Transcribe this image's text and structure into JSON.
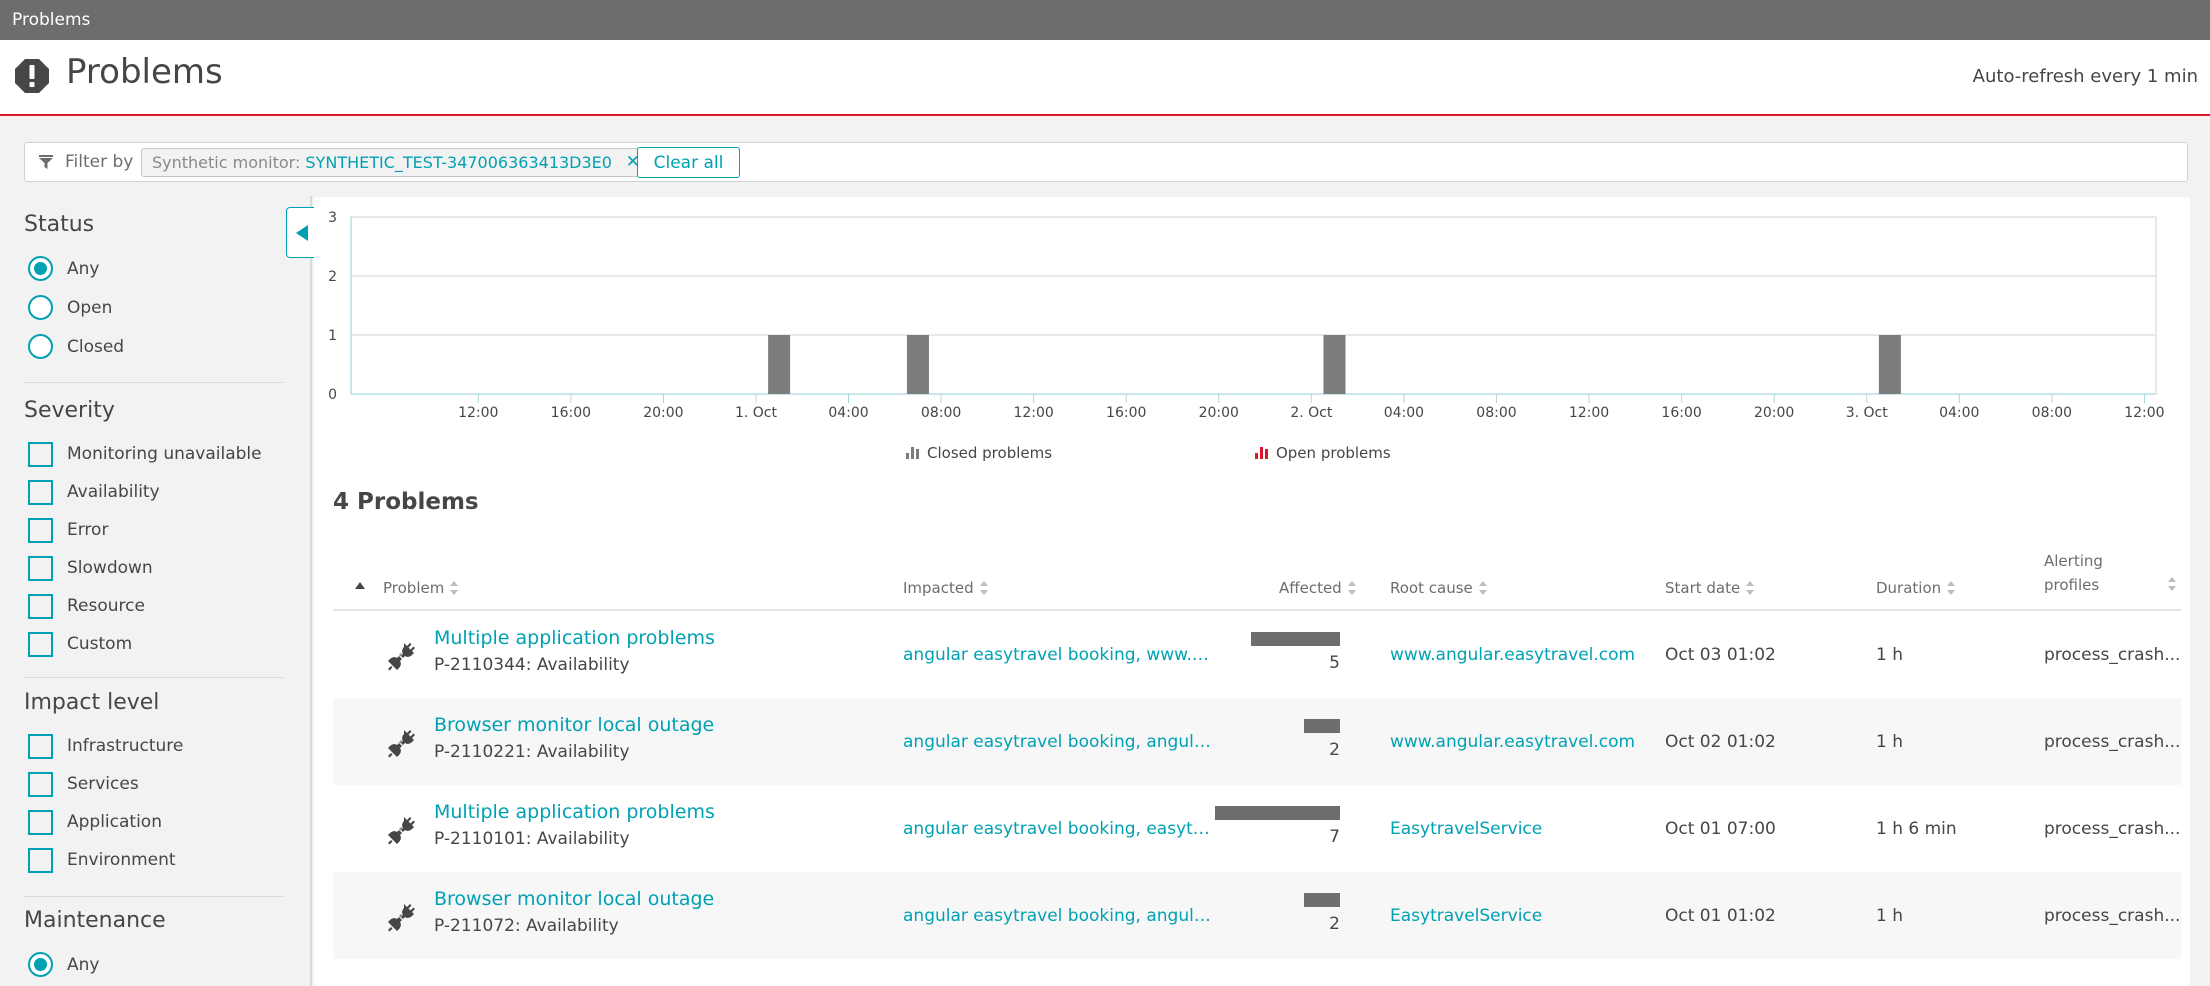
{
  "window": {
    "title": "Problems"
  },
  "header": {
    "title": "Problems",
    "icon": "exclamation-octagon-icon",
    "auto_refresh": "Auto-refresh every 1 min"
  },
  "filter": {
    "label": "Filter by",
    "chips": [
      {
        "key": "Synthetic monitor: ",
        "value": "SYNTHETIC_TEST-347006363413D3E0"
      }
    ],
    "clear_all": "Clear all"
  },
  "sidebar": {
    "status": {
      "title": "Status",
      "options": [
        {
          "label": "Any",
          "checked": true
        },
        {
          "label": "Open",
          "checked": false
        },
        {
          "label": "Closed",
          "checked": false
        }
      ]
    },
    "severity": {
      "title": "Severity",
      "options": [
        {
          "label": "Monitoring unavailable"
        },
        {
          "label": "Availability"
        },
        {
          "label": "Error"
        },
        {
          "label": "Slowdown"
        },
        {
          "label": "Resource"
        },
        {
          "label": "Custom"
        }
      ]
    },
    "impact": {
      "title": "Impact level",
      "options": [
        {
          "label": "Infrastructure"
        },
        {
          "label": "Services"
        },
        {
          "label": "Application"
        },
        {
          "label": "Environment"
        }
      ]
    },
    "maintenance": {
      "title": "Maintenance",
      "options": [
        {
          "label": "Any",
          "checked": true
        }
      ]
    }
  },
  "chart_data": {
    "type": "bar",
    "title": "",
    "xlabel": "",
    "ylabel": "",
    "ylim": [
      0,
      3
    ],
    "yticks": [
      0,
      1,
      2,
      3
    ],
    "grid": true,
    "x_range_hours_from_first_tick": [
      -5.5,
      72.5
    ],
    "xticks": [
      {
        "label": "12:00",
        "hour": 0
      },
      {
        "label": "16:00",
        "hour": 4
      },
      {
        "label": "20:00",
        "hour": 8
      },
      {
        "label": "1. Oct",
        "hour": 12
      },
      {
        "label": "04:00",
        "hour": 16
      },
      {
        "label": "08:00",
        "hour": 20
      },
      {
        "label": "12:00",
        "hour": 24
      },
      {
        "label": "16:00",
        "hour": 28
      },
      {
        "label": "20:00",
        "hour": 32
      },
      {
        "label": "2. Oct",
        "hour": 36
      },
      {
        "label": "04:00",
        "hour": 40
      },
      {
        "label": "08:00",
        "hour": 44
      },
      {
        "label": "12:00",
        "hour": 48
      },
      {
        "label": "16:00",
        "hour": 52
      },
      {
        "label": "20:00",
        "hour": 56
      },
      {
        "label": "3. Oct",
        "hour": 60
      },
      {
        "label": "04:00",
        "hour": 64
      },
      {
        "label": "08:00",
        "hour": 68
      },
      {
        "label": "12:00",
        "hour": 72
      }
    ],
    "series": [
      {
        "name": "Closed problems",
        "color": "#7c7c7c",
        "points": [
          {
            "time": "1. Oct 01:00",
            "hour": 13,
            "value": 1
          },
          {
            "time": "1. Oct 07:00",
            "hour": 19,
            "value": 1
          },
          {
            "time": "2. Oct 01:00",
            "hour": 37,
            "value": 1
          },
          {
            "time": "3. Oct 01:00",
            "hour": 61,
            "value": 1
          }
        ]
      },
      {
        "name": "Open problems",
        "color": "#dc172a",
        "points": []
      }
    ],
    "legend": [
      "Closed problems",
      "Open problems"
    ],
    "legend_position": "bottom"
  },
  "problems": {
    "count_label": "4 Problems",
    "columns": {
      "problem": "Problem",
      "impacted": "Impacted",
      "affected": "Affected",
      "root_cause": "Root cause",
      "start_date": "Start date",
      "duration": "Duration",
      "alerting_line1": "Alerting",
      "alerting_line2": "profiles"
    },
    "rows": [
      {
        "title": "Multiple application problems",
        "subtitle": "P-2110344: Availability",
        "impacted": "angular easytravel booking, www.an...",
        "affected": 5,
        "root_cause": "www.angular.easytravel.com",
        "start_date": "Oct 03 01:02",
        "duration": "1 h",
        "alerting": "process_crash..."
      },
      {
        "title": "Browser monitor local outage",
        "subtitle": "P-2110221: Availability",
        "impacted": "angular easytravel booking, angular ...",
        "affected": 2,
        "root_cause": "www.angular.easytravel.com",
        "start_date": "Oct 02 01:02",
        "duration": "1 h",
        "alerting": "process_crash..."
      },
      {
        "title": "Multiple application problems",
        "subtitle": "P-2110101: Availability",
        "impacted": "angular easytravel booking, easytrav...",
        "affected": 7,
        "root_cause": "EasytravelService",
        "start_date": "Oct 01 07:00",
        "duration": "1 h 6 min",
        "alerting": "process_crash..."
      },
      {
        "title": "Browser monitor local outage",
        "subtitle": "P-211072: Availability",
        "impacted": "angular easytravel booking, angular ...",
        "affected": 2,
        "root_cause": "EasytravelService",
        "start_date": "Oct 01 01:02",
        "duration": "1 h",
        "alerting": "process_crash..."
      }
    ]
  },
  "colors": {
    "accent": "#00a1b2",
    "alert": "#dc172a",
    "text": "#454646",
    "bar": "#7c7c7c"
  }
}
